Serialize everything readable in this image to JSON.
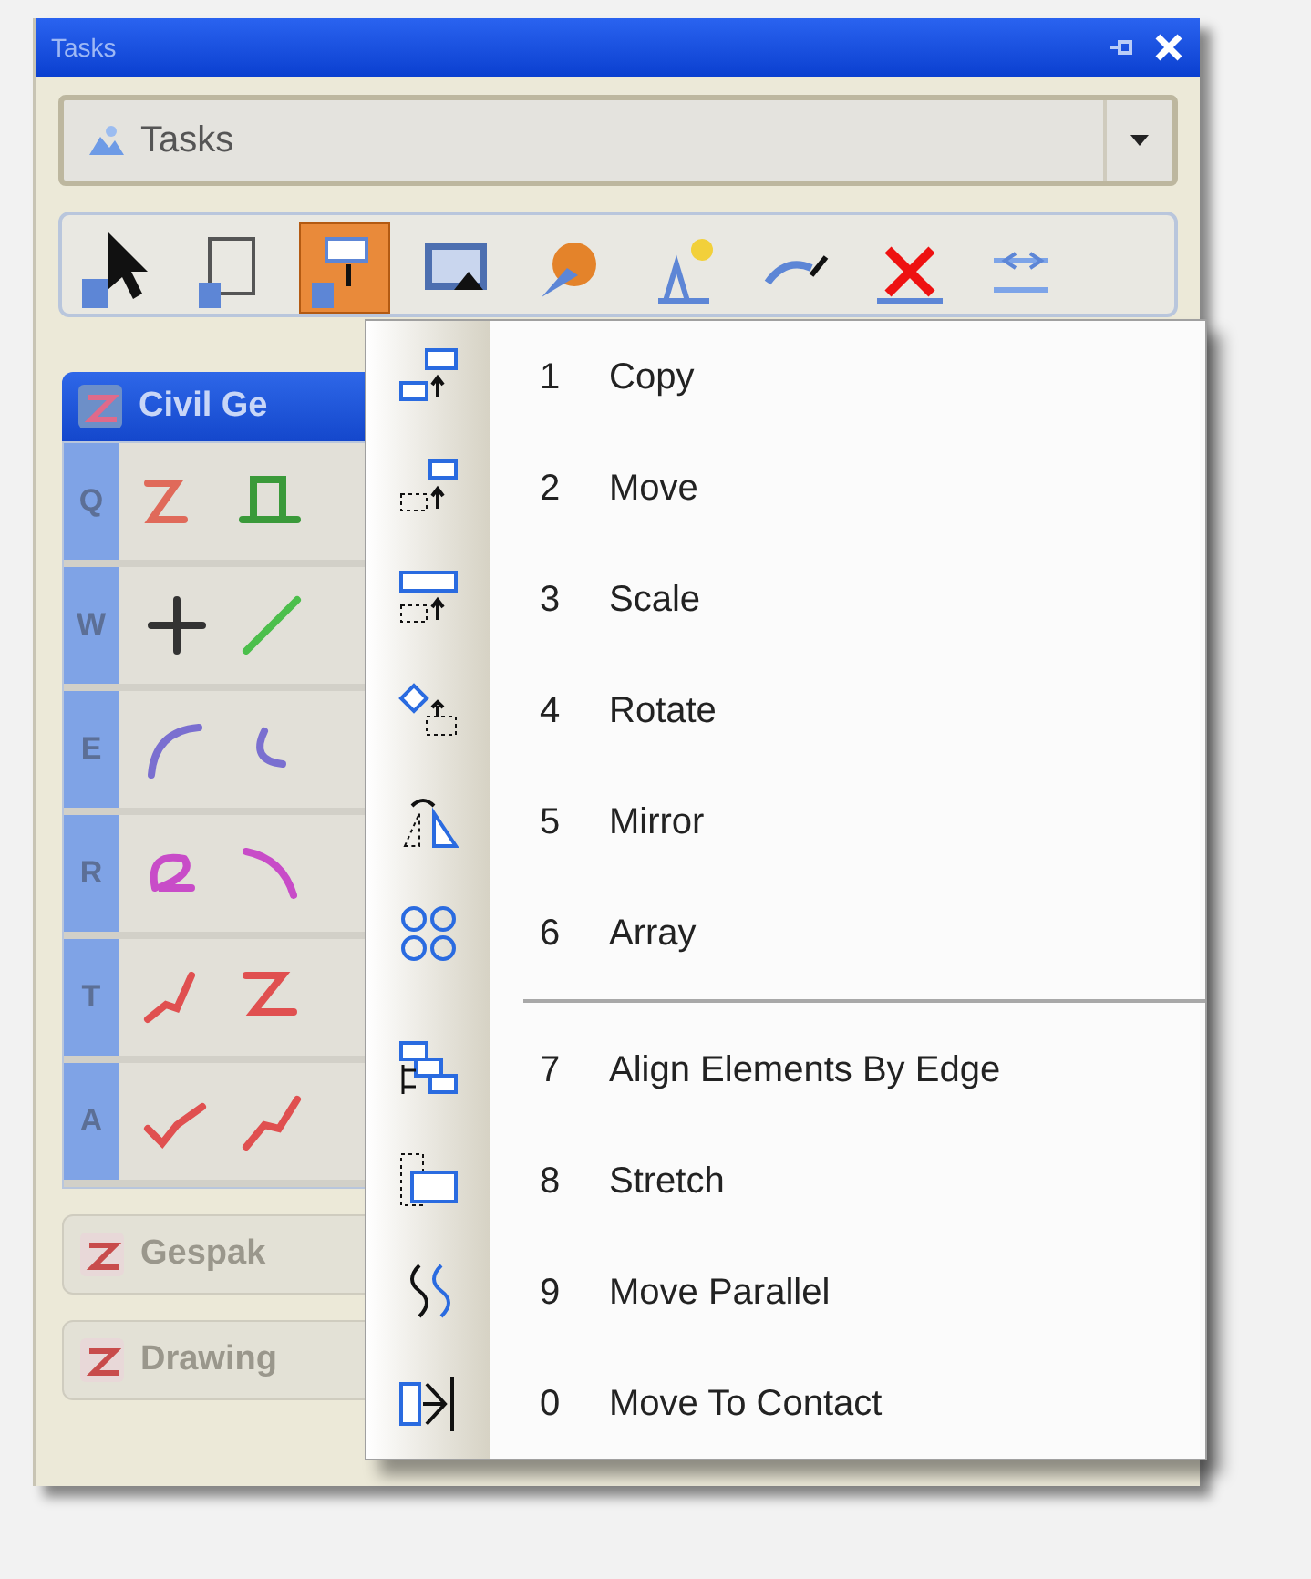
{
  "window": {
    "title": "Tasks"
  },
  "task_dropdown": {
    "value": "Tasks"
  },
  "toolbar": {
    "tools": [
      {
        "selected": false
      },
      {
        "selected": false
      },
      {
        "selected": true
      },
      {
        "selected": false
      },
      {
        "selected": false
      },
      {
        "selected": false
      },
      {
        "selected": false
      },
      {
        "selected": false
      },
      {
        "selected": false
      }
    ]
  },
  "task_groups": [
    {
      "label": "Civil Ge",
      "expanded": true,
      "rows": [
        {
          "key": "Q"
        },
        {
          "key": "W"
        },
        {
          "key": "E"
        },
        {
          "key": "R"
        },
        {
          "key": "T"
        },
        {
          "key": "A"
        }
      ]
    },
    {
      "label": "Gespak",
      "expanded": false
    },
    {
      "label": "Drawing",
      "expanded": false
    }
  ],
  "context_menu": {
    "items": [
      {
        "kind": "item",
        "number": "1",
        "label": "Copy"
      },
      {
        "kind": "item",
        "number": "2",
        "label": "Move"
      },
      {
        "kind": "item",
        "number": "3",
        "label": "Scale"
      },
      {
        "kind": "item",
        "number": "4",
        "label": "Rotate"
      },
      {
        "kind": "item",
        "number": "5",
        "label": "Mirror"
      },
      {
        "kind": "item",
        "number": "6",
        "label": "Array"
      },
      {
        "kind": "separator"
      },
      {
        "kind": "item",
        "number": "7",
        "label": "Align Elements By Edge"
      },
      {
        "kind": "item",
        "number": "8",
        "label": "Stretch"
      },
      {
        "kind": "item",
        "number": "9",
        "label": "Move Parallel"
      },
      {
        "kind": "item",
        "number": "0",
        "label": "Move To Contact"
      }
    ]
  }
}
